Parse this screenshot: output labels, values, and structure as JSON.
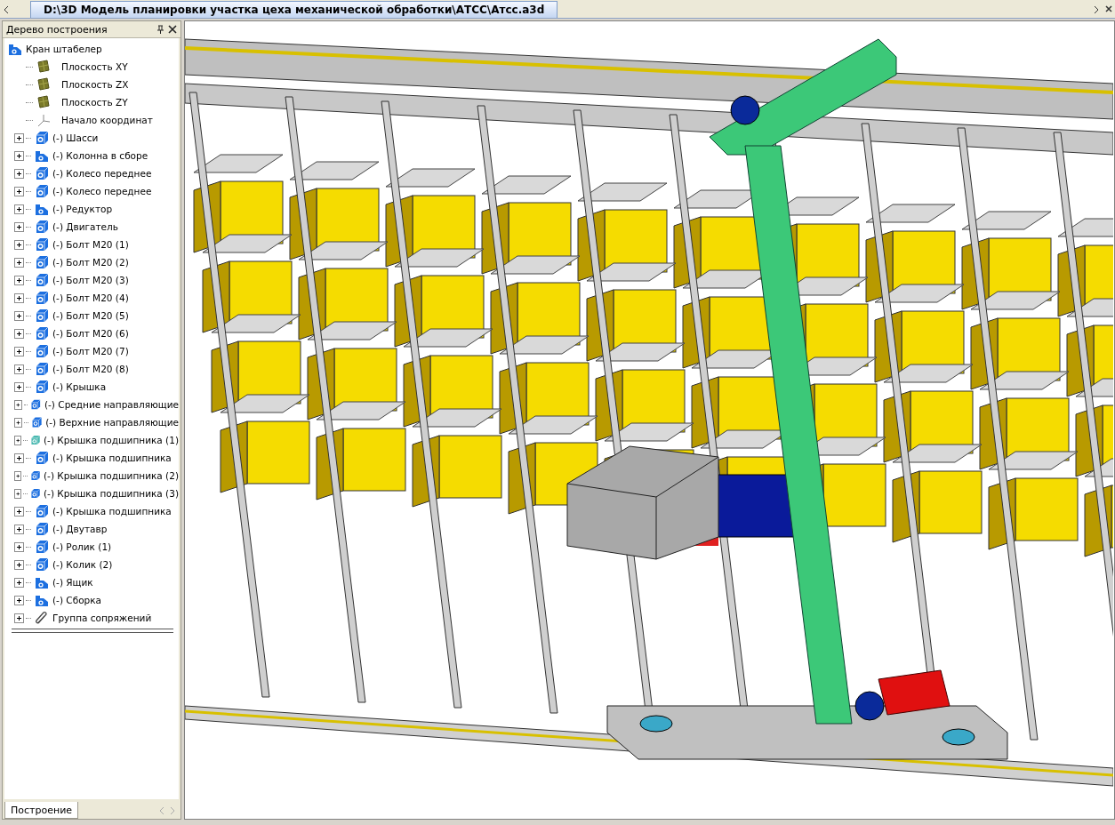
{
  "window": {
    "title": "D:\\3D Модель планировки участка цеха механической обработки\\АТСС\\Атсс.a3d"
  },
  "tree_panel": {
    "title": "Дерево построения",
    "root": {
      "label": "Кран штабелер",
      "kind": "assembly",
      "children": [
        {
          "label": "Плоскость XY",
          "kind": "plane"
        },
        {
          "label": "Плоскость ZX",
          "kind": "plane"
        },
        {
          "label": "Плоскость ZY",
          "kind": "plane"
        },
        {
          "label": "Начало координат",
          "kind": "origin"
        },
        {
          "label": "(-) Шасси",
          "kind": "part",
          "color": "#1c6fe0"
        },
        {
          "label": "(-) Колонна в сборе",
          "kind": "assembly",
          "color": "#1c6fe0"
        },
        {
          "label": "(-) Колесо переднее",
          "kind": "part",
          "color": "#1c6fe0"
        },
        {
          "label": "(-) Колесо переднее",
          "kind": "part",
          "color": "#1c6fe0"
        },
        {
          "label": "(-) Редуктор",
          "kind": "assembly",
          "color": "#1c6fe0"
        },
        {
          "label": "(-) Двигатель",
          "kind": "part",
          "color": "#1c6fe0"
        },
        {
          "label": "(-) Болт М20 (1)",
          "kind": "part",
          "color": "#1c6fe0"
        },
        {
          "label": "(-) Болт М20 (2)",
          "kind": "part",
          "color": "#1c6fe0"
        },
        {
          "label": "(-) Болт М20 (3)",
          "kind": "part",
          "color": "#1c6fe0"
        },
        {
          "label": "(-) Болт М20 (4)",
          "kind": "part",
          "color": "#1c6fe0"
        },
        {
          "label": "(-) Болт М20 (5)",
          "kind": "part",
          "color": "#1c6fe0"
        },
        {
          "label": "(-) Болт М20 (6)",
          "kind": "part",
          "color": "#1c6fe0"
        },
        {
          "label": "(-) Болт М20 (7)",
          "kind": "part",
          "color": "#1c6fe0"
        },
        {
          "label": "(-) Болт М20 (8)",
          "kind": "part",
          "color": "#1c6fe0"
        },
        {
          "label": "(-) Крышка",
          "kind": "part",
          "color": "#1c6fe0"
        },
        {
          "label": "(-) Средние направляющие",
          "kind": "part",
          "color": "#1c6fe0"
        },
        {
          "label": "(-) Верхние направляющие",
          "kind": "part",
          "color": "#1c6fe0"
        },
        {
          "label": "(-) Крышка подшипника (1)",
          "kind": "part",
          "color": "#48b8b0"
        },
        {
          "label": "(-) Крышка подшипника",
          "kind": "part",
          "color": "#1c6fe0"
        },
        {
          "label": "(-) Крышка подшипника (2)",
          "kind": "part",
          "color": "#1c6fe0"
        },
        {
          "label": "(-) Крышка подшипника (3)",
          "kind": "part",
          "color": "#1c6fe0"
        },
        {
          "label": "(-) Крышка подшипника",
          "kind": "part",
          "color": "#1c6fe0"
        },
        {
          "label": "(-) Двутавр",
          "kind": "part",
          "color": "#1c6fe0"
        },
        {
          "label": "(-) Ролик (1)",
          "kind": "part",
          "color": "#1c6fe0"
        },
        {
          "label": "(-) Колик (2)",
          "kind": "part",
          "color": "#1c6fe0"
        },
        {
          "label": "(-) Ящик",
          "kind": "assembly",
          "color": "#1c6fe0"
        },
        {
          "label": "(-) Сборка",
          "kind": "assembly",
          "color": "#1c6fe0"
        },
        {
          "label": "Группа сопряжений",
          "kind": "mates"
        }
      ]
    },
    "tabs": [
      {
        "label": "Построение",
        "selected": true
      }
    ]
  }
}
